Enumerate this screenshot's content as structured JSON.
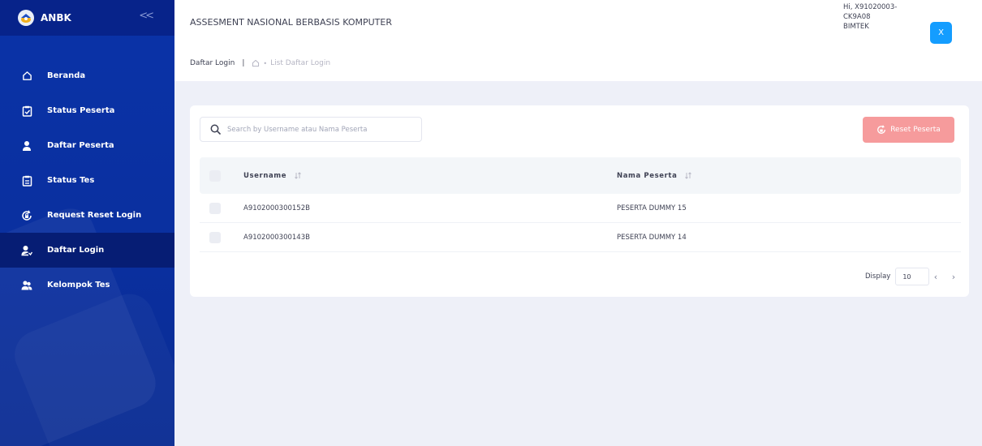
{
  "sidebar": {
    "brand": "ANBK",
    "items": [
      {
        "label": "Beranda",
        "icon": "home-icon"
      },
      {
        "label": "Status Peserta",
        "icon": "clipboard-check-icon"
      },
      {
        "label": "Daftar Peserta",
        "icon": "user-icon"
      },
      {
        "label": "Status Tes",
        "icon": "clipboard-list-icon"
      },
      {
        "label": "Request Reset Login",
        "icon": "reset-lock-icon"
      },
      {
        "label": "Daftar Login",
        "icon": "user-login-icon",
        "active": true
      },
      {
        "label": "Kelompok Tes",
        "icon": "users-group-icon"
      }
    ]
  },
  "header": {
    "title": "ASSESMENT NASIONAL BERBASIS KOMPUTER",
    "breadcrumb": {
      "page": "Daftar Login",
      "separator": "|",
      "dot": "•",
      "current": "List Daftar Login"
    },
    "user": {
      "line1": "Hi, X91020003-",
      "line2": "CK9A08",
      "line3": "BIMTEK",
      "badge": "X"
    }
  },
  "main": {
    "search_placeholder": "Search by Username atau Nama Peserta",
    "reset_label": "Reset Peserta",
    "table": {
      "columns": [
        "Username",
        "Nama Peserta"
      ],
      "rows": [
        {
          "username": "A9102000300152B",
          "nama": "PESERTA DUMMY 15"
        },
        {
          "username": "A9102000300143B",
          "nama": "PESERTA DUMMY 14"
        }
      ]
    },
    "display_label": "Display",
    "display_value": "10",
    "pager_prev": "‹",
    "pager_next": "›"
  },
  "colors": {
    "sidebar_bg": "#0a33a8",
    "sidebar_active": "#061d74",
    "accent_blue": "#149dff",
    "reset_button": "#f69b9c",
    "page_bg": "#eef0f8"
  }
}
